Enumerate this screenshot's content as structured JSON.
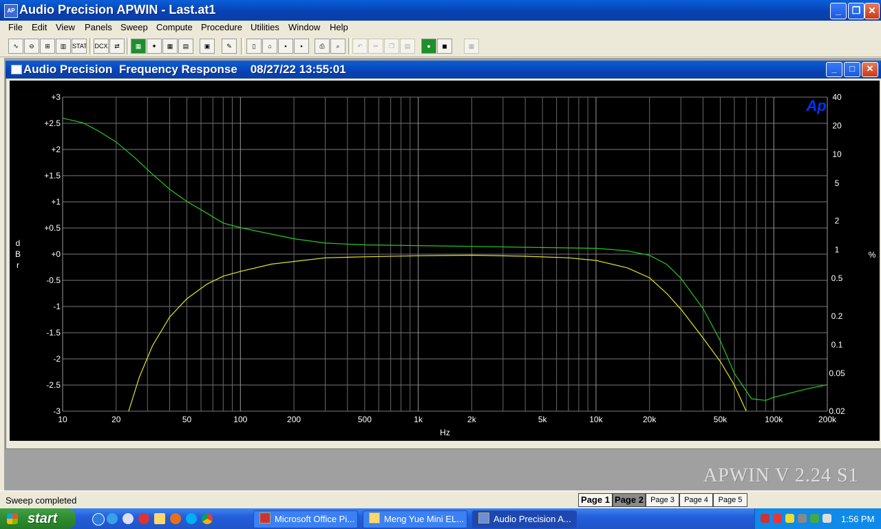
{
  "window": {
    "title": "Audio Precision APWIN - Last.at1",
    "icon": "apwin-app-icon",
    "icon_text": "AP"
  },
  "menu": [
    "File",
    "Edit",
    "View",
    "Panels",
    "Sweep",
    "Compute",
    "Procedure",
    "Utilities",
    "Window",
    "Help"
  ],
  "toolbar": {
    "stat_label": "STAT",
    "dcx_label": "DCX"
  },
  "graph_window": {
    "title": "Audio Precision  Frequency Response    08/27/22 13:55:01"
  },
  "chart_data": {
    "type": "line",
    "background": "#000000",
    "grid": true,
    "x_scale": "log",
    "xlabel": "Hz",
    "xlim": [
      10,
      200000
    ],
    "x_ticks": [
      {
        "v": 10,
        "label": "10"
      },
      {
        "v": 20,
        "label": "20"
      },
      {
        "v": 50,
        "label": "50"
      },
      {
        "v": 100,
        "label": "100"
      },
      {
        "v": 200,
        "label": "200"
      },
      {
        "v": 500,
        "label": "500"
      },
      {
        "v": 1000,
        "label": "1k"
      },
      {
        "v": 2000,
        "label": "2k"
      },
      {
        "v": 5000,
        "label": "5k"
      },
      {
        "v": 10000,
        "label": "10k"
      },
      {
        "v": 20000,
        "label": "20k"
      },
      {
        "v": 50000,
        "label": "50k"
      },
      {
        "v": 100000,
        "label": "100k"
      },
      {
        "v": 200000,
        "label": "200k"
      }
    ],
    "y_left": {
      "label": "dBr",
      "lim": [
        -3,
        3
      ],
      "ticks": [
        {
          "v": 3,
          "label": "+3"
        },
        {
          "v": 2.5,
          "label": "+2.5"
        },
        {
          "v": 2,
          "label": "+2"
        },
        {
          "v": 1.5,
          "label": "+1.5"
        },
        {
          "v": 1,
          "label": "+1"
        },
        {
          "v": 0.5,
          "label": "+0.5"
        },
        {
          "v": 0,
          "label": "+0"
        },
        {
          "v": -0.5,
          "label": "-0.5"
        },
        {
          "v": -1,
          "label": "-1"
        },
        {
          "v": -1.5,
          "label": "-1.5"
        },
        {
          "v": -2,
          "label": "-2"
        },
        {
          "v": -2.5,
          "label": "-2.5"
        },
        {
          "v": -3,
          "label": "-3"
        }
      ]
    },
    "y_right": {
      "label": "%",
      "scale": "log",
      "lim": [
        0.02,
        40
      ],
      "ticks": [
        {
          "v": 40,
          "label": "40"
        },
        {
          "v": 20,
          "label": "20"
        },
        {
          "v": 10,
          "label": "10"
        },
        {
          "v": 5,
          "label": "5"
        },
        {
          "v": 2,
          "label": "2"
        },
        {
          "v": 1,
          "label": "1"
        },
        {
          "v": 0.5,
          "label": "0.5"
        },
        {
          "v": 0.2,
          "label": "0.2"
        },
        {
          "v": 0.1,
          "label": "0.1"
        },
        {
          "v": 0.05,
          "label": "0.05"
        },
        {
          "v": 0.02,
          "label": "0.02"
        }
      ]
    },
    "logo": "Ap",
    "logo_color": "#0033ff",
    "series": [
      {
        "color": "#e8e820",
        "axis": "left",
        "points": [
          [
            23.5,
            -3.0
          ],
          [
            27,
            -2.35
          ],
          [
            32,
            -1.75
          ],
          [
            40,
            -1.2
          ],
          [
            50,
            -0.85
          ],
          [
            65,
            -0.57
          ],
          [
            80,
            -0.42
          ],
          [
            100,
            -0.33
          ],
          [
            150,
            -0.19
          ],
          [
            200,
            -0.14
          ],
          [
            300,
            -0.07
          ],
          [
            500,
            -0.05
          ],
          [
            1000,
            -0.03
          ],
          [
            2000,
            -0.02
          ],
          [
            4000,
            -0.04
          ],
          [
            7000,
            -0.07
          ],
          [
            10000,
            -0.12
          ],
          [
            15000,
            -0.26
          ],
          [
            20000,
            -0.45
          ],
          [
            25000,
            -0.75
          ],
          [
            30000,
            -1.05
          ],
          [
            40000,
            -1.6
          ],
          [
            50000,
            -2.05
          ],
          [
            60000,
            -2.5
          ],
          [
            70000,
            -3.0
          ]
        ]
      },
      {
        "color": "#22cc22",
        "axis": "right",
        "points": [
          [
            10,
            24
          ],
          [
            13,
            21.5
          ],
          [
            16,
            17.5
          ],
          [
            20,
            13.5
          ],
          [
            25,
            9.5
          ],
          [
            32,
            6.2
          ],
          [
            40,
            4.3
          ],
          [
            50,
            3.2
          ],
          [
            65,
            2.4
          ],
          [
            80,
            1.9
          ],
          [
            100,
            1.7
          ],
          [
            150,
            1.45
          ],
          [
            200,
            1.3
          ],
          [
            300,
            1.17
          ],
          [
            500,
            1.12
          ],
          [
            1000,
            1.1
          ],
          [
            2000,
            1.08
          ],
          [
            5000,
            1.05
          ],
          [
            10000,
            1.03
          ],
          [
            15000,
            0.97
          ],
          [
            20000,
            0.87
          ],
          [
            25000,
            0.7
          ],
          [
            30000,
            0.5
          ],
          [
            40000,
            0.24
          ],
          [
            50000,
            0.11
          ],
          [
            60000,
            0.05
          ],
          [
            75000,
            0.027
          ],
          [
            90000,
            0.026
          ],
          [
            100000,
            0.028
          ],
          [
            150000,
            0.034
          ],
          [
            200000,
            0.038
          ]
        ]
      }
    ]
  },
  "watermark": "APWIN V 2.24 S1",
  "status": {
    "text": "Sweep completed",
    "pages": [
      "Page 1",
      "Page 2",
      "Page 3",
      "Page 4",
      "Page 5"
    ],
    "selected_page": "Page 2"
  },
  "taskbar": {
    "start": "start",
    "tasks": [
      "Microsoft Office Pi...",
      "Meng Yue Mini EL...",
      "Audio Precision A..."
    ],
    "active_task": "Audio Precision A...",
    "clock": "1:56 PM"
  }
}
